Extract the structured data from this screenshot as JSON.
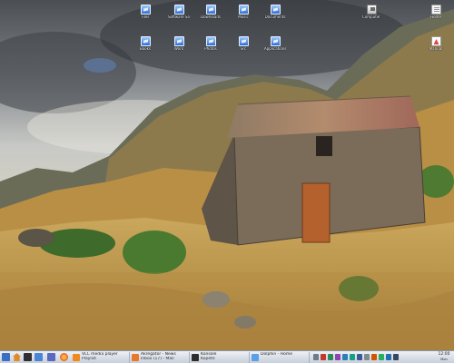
{
  "desktop_icons": [
    {
      "label": "Files",
      "icon": "folder-icon"
    },
    {
      "label": "Software Sources",
      "icon": "folder-icon"
    },
    {
      "label": "Downloads",
      "icon": "folder-icon"
    },
    {
      "label": "Music",
      "icon": "folder-icon"
    },
    {
      "label": "Documents",
      "icon": "folder-icon"
    },
    {
      "label": "Books",
      "icon": "folder-icon"
    },
    {
      "label": "Work",
      "icon": "folder-icon"
    },
    {
      "label": "Photos",
      "icon": "folder-icon"
    },
    {
      "label": "Src",
      "icon": "folder-icon"
    },
    {
      "label": "Applications",
      "icon": "folder-icon"
    },
    {
      "label": "Computer",
      "icon": "computer-icon"
    },
    {
      "label": "Home",
      "icon": "document-icon"
    },
    {
      "label": "Manual",
      "icon": "pdf-icon"
    }
  ],
  "taskbar": {
    "launchers": [
      "start-menu-icon",
      "home-icon",
      "terminal-icon",
      "file-manager-icon",
      "system-monitor-icon",
      "browser-icon"
    ],
    "tasks": [
      {
        "line1": "VLC media player",
        "line2": "Playlist"
      },
      {
        "line1": "Akregator - News",
        "line2": "Inbox (17) - Mail"
      },
      {
        "line1": "Konsole",
        "line2": "Kopete"
      },
      {
        "line1": "Dolphin - Home",
        "line2": ""
      }
    ],
    "tray_icons": [
      "volume-icon",
      "network-icon",
      "battery-icon",
      "clipboard-icon",
      "update-icon",
      "chat-icon",
      "bluetooth-icon",
      "printer-icon",
      "power-icon",
      "calendar-icon",
      "info-icon",
      "screen-icon"
    ],
    "clock_time": "12:00",
    "clock_date": "Mon"
  }
}
